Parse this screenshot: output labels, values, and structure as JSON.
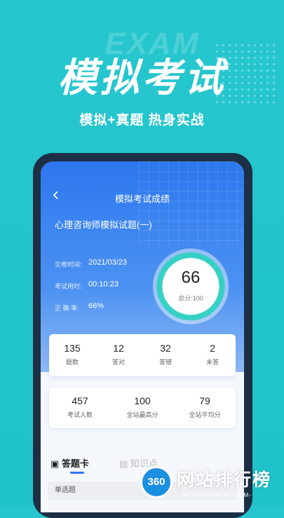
{
  "promo": {
    "deco_text": "EXAM",
    "title": "模拟考试",
    "subtitle": "模拟+真题  热身实战"
  },
  "nav": {
    "title": "模拟考试成绩"
  },
  "exam": {
    "name": "心理咨询师模拟试题(一)",
    "submit_time_label": "交卷时间:",
    "submit_time": "2021/03/23",
    "duration_label": "考试用时:",
    "duration": "00:10:23",
    "accuracy_label": "正 确 率:",
    "accuracy": "66%"
  },
  "score": {
    "value": "66",
    "total": "总分:100"
  },
  "stats": [
    {
      "value": "135",
      "label": "题数"
    },
    {
      "value": "12",
      "label": "答对"
    },
    {
      "value": "32",
      "label": "答错"
    },
    {
      "value": "2",
      "label": "未答"
    }
  ],
  "ranking": [
    {
      "value": "457",
      "label": "考试人数"
    },
    {
      "value": "100",
      "label": "全站最高分"
    },
    {
      "value": "79",
      "label": "全站平均分"
    }
  ],
  "tabs": {
    "answer_card": "答题卡",
    "knowledge": "知识点"
  },
  "section": {
    "single_choice": "单选题"
  },
  "watermark": {
    "badge": "360",
    "text": "网站排行榜",
    "sub": "-WANGZHAN360.COM-"
  },
  "colors": {
    "bg": "#27c6cf",
    "hero": "#2d77ee",
    "ring": "#34d1c4"
  }
}
